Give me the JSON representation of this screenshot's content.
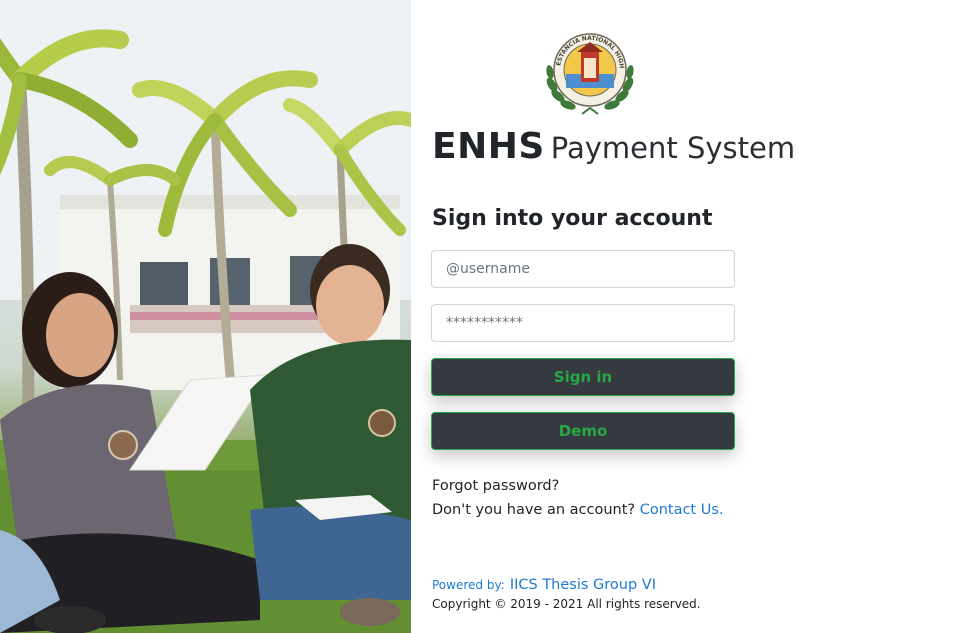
{
  "app": {
    "brand": "ENHS",
    "subtitle": "Payment System",
    "logo_text": "ESTANCIA NATIONAL HIGH SCHOOL"
  },
  "form": {
    "heading": "Sign into your account",
    "username_placeholder": "@username",
    "password_placeholder": "***********",
    "signin_label": "Sign in",
    "demo_label": "Demo"
  },
  "links": {
    "forgot_password": "Forgot password?",
    "no_account_text": "Don't you have an account?",
    "contact_us": "Contact Us."
  },
  "footer": {
    "powered_by": "Powered by:",
    "group": "IICS Thesis Group VI",
    "copyright": "Copyright © 2019 - 2021 All rights reserved."
  },
  "colors": {
    "button_bg": "#343a40",
    "button_accent": "#28a745",
    "link": "#1e7ad6"
  },
  "icons": {
    "logo": "school-seal-icon",
    "photo": "students-campus-photo"
  }
}
